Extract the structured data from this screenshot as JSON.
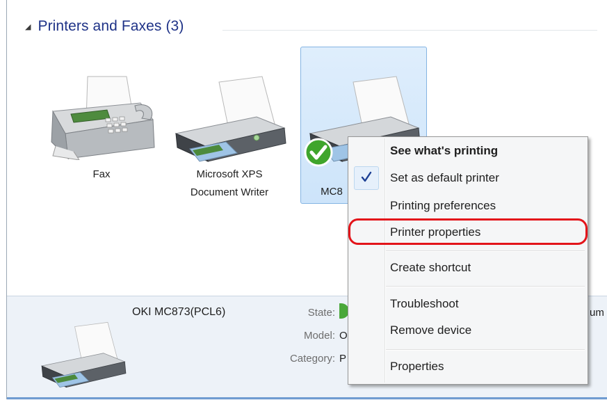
{
  "group": {
    "caret_icon": "collapse-triangle-icon",
    "title": "Printers and Faxes (3)"
  },
  "devices": [
    {
      "label": "Fax",
      "icon": "fax-machine-icon"
    },
    {
      "label_line1": "Microsoft XPS",
      "label_line2": "Document Writer",
      "icon": "printer-icon"
    },
    {
      "label": "MC8",
      "icon": "printer-icon",
      "default_badge": "default-check-badge-icon"
    }
  ],
  "context_menu": {
    "items": [
      {
        "label": "See what's printing",
        "bold": true
      },
      {
        "label": "Set as default printer",
        "checked": true
      },
      {
        "label": "Printing preferences"
      },
      {
        "label": "Printer properties",
        "highlighted": true
      },
      {
        "label": "Create shortcut"
      },
      {
        "label": "Troubleshoot"
      },
      {
        "label": "Remove device"
      },
      {
        "label": "Properties"
      }
    ],
    "highlight_color": "#e3141a"
  },
  "details": {
    "name": "OKI MC873(PCL6)",
    "state_label": "State:",
    "state_value_fragment": "um",
    "model_label": "Model:",
    "model_value_fragment": "O",
    "category_label": "Category:",
    "category_value_fragment": "P"
  },
  "colors": {
    "group_title": "#1e3287",
    "selection_border": "#84b4e3",
    "details_bg": "#edf2f8"
  }
}
